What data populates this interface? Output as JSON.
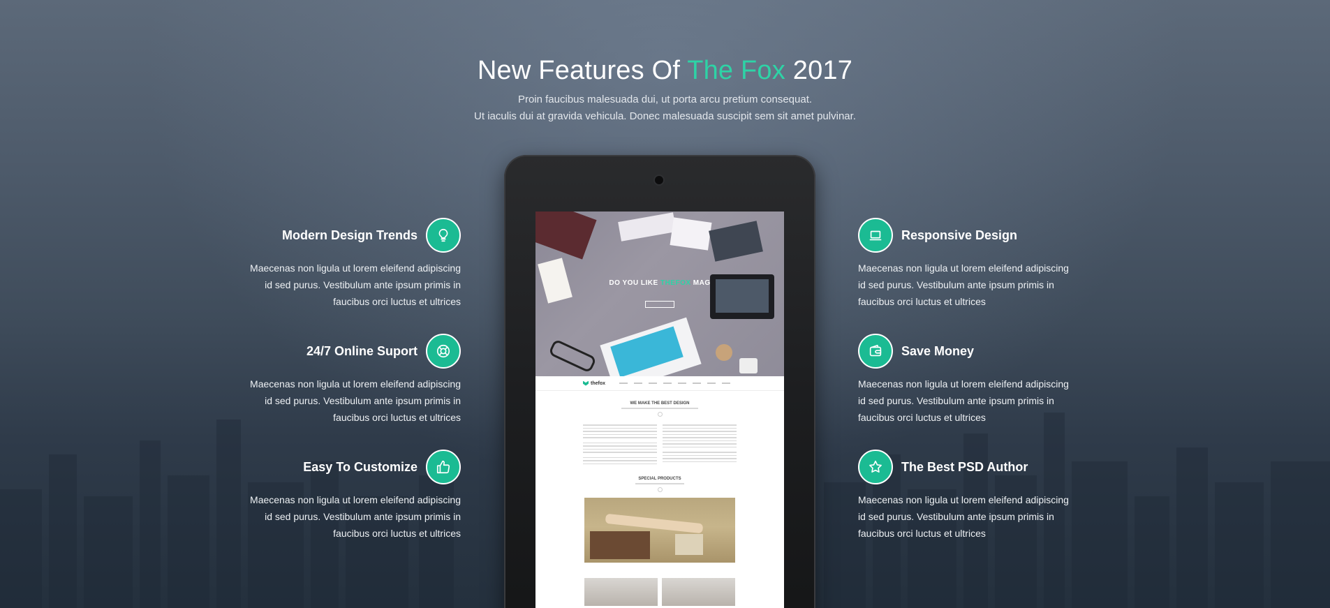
{
  "header": {
    "title_prefix": "New Features Of ",
    "title_accent": "The Fox",
    "title_suffix": " 2017",
    "subtitle_line1": "Proin faucibus malesuada dui, ut porta arcu pretium consequat.",
    "subtitle_line2": "Ut iaculis dui at gravida vehicula. Donec malesuada suscipit sem sit amet pulvinar."
  },
  "colors": {
    "accent": "#2ed3a6",
    "icon_fill": "#1bbb93",
    "text": "#ffffff"
  },
  "features_left": [
    {
      "title": "Modern Design Trends",
      "icon": "lightbulb-icon",
      "desc_line1": "Maecenas non ligula ut lorem eleifend adipiscing",
      "desc_line2": "id sed purus. Vestibulum ante ipsum primis in",
      "desc_line3": "faucibus orci luctus et ultrices"
    },
    {
      "title": "24/7 Online Suport",
      "icon": "lifebuoy-icon",
      "desc_line1": "Maecenas non ligula ut lorem eleifend adipiscing",
      "desc_line2": "id sed purus. Vestibulum ante ipsum primis in",
      "desc_line3": "faucibus orci luctus et ultrices"
    },
    {
      "title": "Easy To Customize",
      "icon": "thumbs-up-icon",
      "desc_line1": "Maecenas non ligula ut lorem eleifend adipiscing",
      "desc_line2": "id sed purus. Vestibulum ante ipsum primis in",
      "desc_line3": "faucibus orci luctus et ultrices"
    }
  ],
  "features_right": [
    {
      "title": "Responsive Design",
      "icon": "laptop-icon",
      "desc_line1": "Maecenas non ligula ut lorem eleifend adipiscing",
      "desc_line2": "id sed purus. Vestibulum ante ipsum primis in",
      "desc_line3": "faucibus orci luctus et ultrices"
    },
    {
      "title": "Save Money",
      "icon": "wallet-icon",
      "desc_line1": "Maecenas non ligula ut lorem eleifend adipiscing",
      "desc_line2": "id sed purus. Vestibulum ante ipsum primis in",
      "desc_line3": "faucibus orci luctus et ultrices"
    },
    {
      "title": "The Best PSD Author",
      "icon": "star-icon",
      "desc_line1": "Maecenas non ligula ut lorem eleifend adipiscing",
      "desc_line2": "id sed purus. Vestibulum ante ipsum primis in",
      "desc_line3": "faucibus orci luctus et ultrices"
    }
  ],
  "tablet_screen": {
    "hero_heading_prefix": "DO YOU LIKE ",
    "hero_heading_accent": "THEFOX",
    "hero_heading_suffix": " MAG",
    "logo_text": "thefox",
    "section1_title": "WE MAKE THE BEST DESIGN",
    "section2_title": "SPECIAL PRODUCTS"
  }
}
